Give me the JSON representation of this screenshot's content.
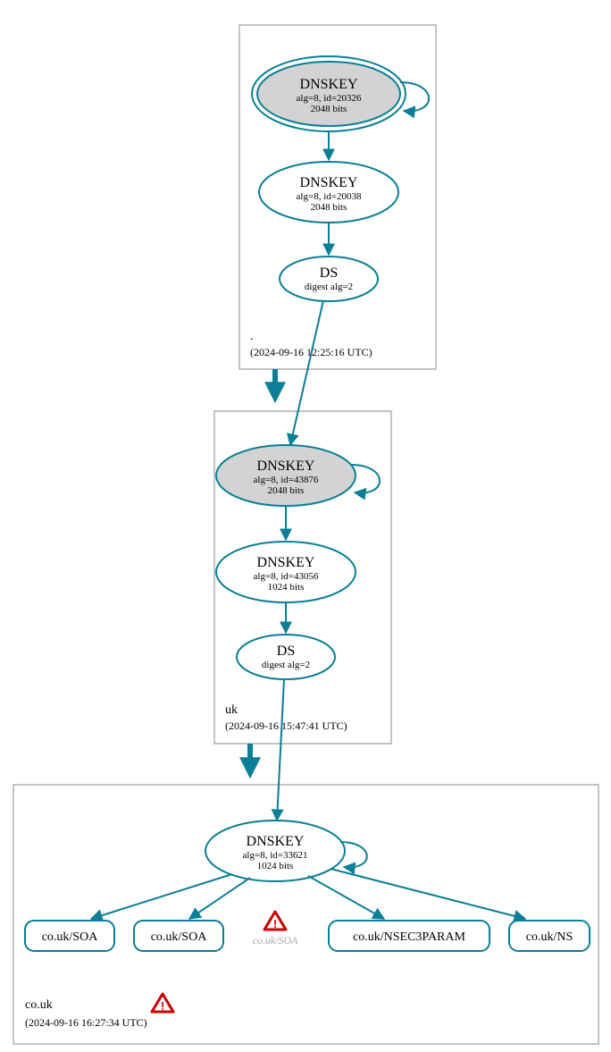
{
  "colors": {
    "stroke": "#0a7f96",
    "box": "#888888",
    "ksk_fill": "#d3d3d3",
    "warn": "#cc0000"
  },
  "zones": {
    "root": {
      "label": ".",
      "timestamp": "(2024-09-16 12:25:16 UTC)"
    },
    "uk": {
      "label": "uk",
      "timestamp": "(2024-09-16 15:47:41 UTC)"
    },
    "couk": {
      "label": "co.uk",
      "timestamp": "(2024-09-16 16:27:34 UTC)"
    }
  },
  "nodes": {
    "root_ksk": {
      "title": "DNSKEY",
      "line1": "alg=8, id=20326",
      "line2": "2048 bits"
    },
    "root_zsk": {
      "title": "DNSKEY",
      "line1": "alg=8, id=20038",
      "line2": "2048 bits"
    },
    "root_ds": {
      "title": "DS",
      "line1": "digest alg=2"
    },
    "uk_ksk": {
      "title": "DNSKEY",
      "line1": "alg=8, id=43876",
      "line2": "2048 bits"
    },
    "uk_zsk": {
      "title": "DNSKEY",
      "line1": "alg=8, id=43056",
      "line2": "1024 bits"
    },
    "uk_ds": {
      "title": "DS",
      "line1": "digest alg=2"
    },
    "couk_zsk": {
      "title": "DNSKEY",
      "line1": "alg=8, id=33621",
      "line2": "1024 bits"
    }
  },
  "records": {
    "soa1": "co.uk/SOA",
    "soa2": "co.uk/SOA",
    "soa3": "co.uk/SOA",
    "nsec3": "co.uk/NSEC3PARAM",
    "ns": "co.uk/NS"
  }
}
